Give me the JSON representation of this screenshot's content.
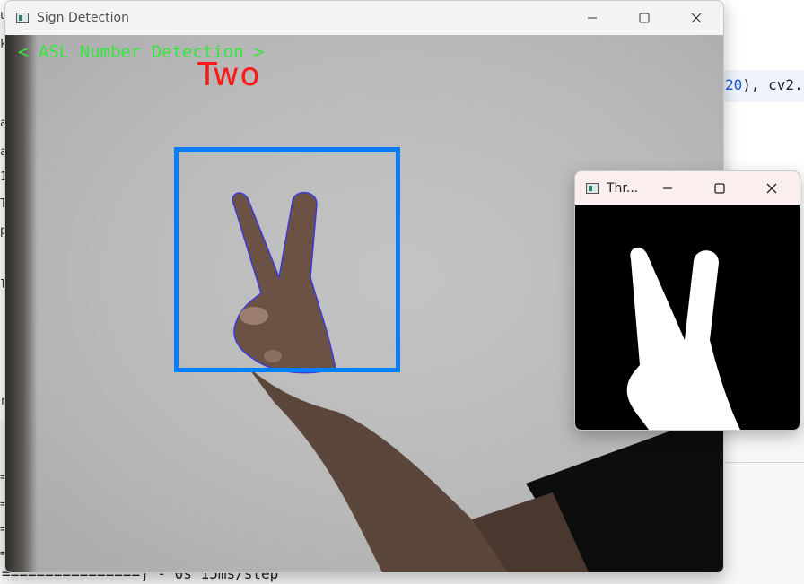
{
  "background": {
    "code_text": "20), cv2.",
    "code_number": "20",
    "code_rest": "), cv2.",
    "terminal_line": "================] - 0s 15ms/step",
    "left_glyphs": [
      "u",
      "k",
      "a",
      "a",
      "1",
      "T",
      "p",
      "le",
      "r",
      "=",
      "=",
      "=",
      "="
    ]
  },
  "main_window": {
    "title": "Sign Detection",
    "overlay_text": "< ASL Number Detection >",
    "prediction": "Two",
    "colors": {
      "overlay_text": "#31e83a",
      "prediction": "#ff1a1a",
      "roi_box": "#0a7cff"
    },
    "controls": [
      "minimize-icon",
      "maximize-icon",
      "close-icon"
    ]
  },
  "threshold_window": {
    "title": "Thr...",
    "controls": [
      "minimize-icon",
      "maximize-icon",
      "close-icon"
    ]
  }
}
